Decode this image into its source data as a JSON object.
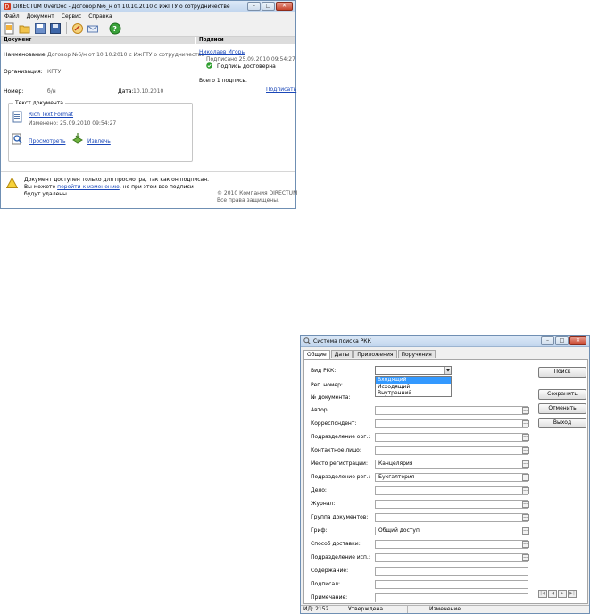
{
  "doc_window": {
    "title": "DIRECTUM OverDoc - Договор №6_н от 10.10.2010 с ИжГТУ о сотрудничестве",
    "menu": [
      "Файл",
      "Документ",
      "Сервис",
      "Справка"
    ],
    "document_header": "Документ",
    "signatures_header": "Подписи",
    "name_label": "Наименование:",
    "name_value": "Договор №6/н от 10.10.2010 с ИжГТУ о сотрудничестве",
    "org_label": "Организация:",
    "org_value": "КГТУ",
    "number_label": "Номер:",
    "number_value": "б/н",
    "date_label": "Дата:",
    "date_value": "10.10.2010",
    "text_group_label": "Текст документа",
    "file_link": "Rich Text Format",
    "file_modified": "Изменено: 25.09.2010 09:54:27",
    "view_link": "Просмотреть",
    "extract_link": "Извлечь",
    "signer_name": "Николаев Игорь",
    "signed_at": "Подписано 25.09.2010 09:54:27",
    "signature_status": "Подпись достоверна",
    "total_signatures": "Всего 1 подпись.",
    "sign_link": "Подписать",
    "warning_line1": "Документ доступен только для просмотра, так как он подписан.",
    "warning_line2_prefix": "Вы можете ",
    "warning_link": "перейти к изменению",
    "warning_line2_suffix": ", но при этом все подписи",
    "warning_line3": "будут удалены.",
    "copyright_line1": "© 2010 Компания DIRECTUM",
    "copyright_line2": "Все права защищены."
  },
  "search_window": {
    "title": "Система поиска РКК",
    "tabs": [
      "Общие",
      "Даты",
      "Приложения",
      "Поручения"
    ],
    "fields": {
      "kind_label": "Вид РКК:",
      "kind_options": [
        "Входящий",
        "Исходящий",
        "Внутренний"
      ],
      "reg_number_label": "Рег. номер:",
      "doc_number_label": "№ документа:",
      "author_label": "Автор:",
      "correspondent_label": "Корреспондент:",
      "org_division_label": "Подразделение орг.:",
      "contact_label": "Контактное лицо:",
      "reg_place_label": "Место регистрации:",
      "reg_place_value": "Канцелярия",
      "reg_division_label": "Подразделение рег.:",
      "reg_division_value": "Бухгалтерия",
      "case_label": "Дело:",
      "journal_label": "Журнал:",
      "doc_group_label": "Группа документов:",
      "stamp_label": "Гриф:",
      "stamp_value": "Общий доступ",
      "delivery_label": "Способ доставки:",
      "exec_division_label": "Подразделение исп.:",
      "content_label": "Содержание:",
      "signed_label": "Подписал:",
      "note_label": "Примечание:"
    },
    "buttons": {
      "search": "Поиск",
      "save": "Сохранить",
      "cancel": "Отменить",
      "exit": "Выход"
    },
    "status": {
      "id": "ИД: 2152",
      "state": "Утверждена",
      "mode": "Изменение"
    }
  }
}
